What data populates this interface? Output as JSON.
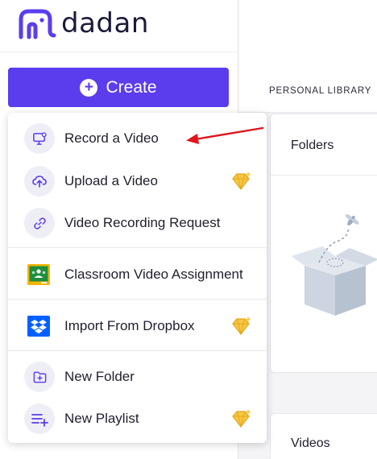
{
  "brand": {
    "name": "dadan",
    "color": "#5b3ded"
  },
  "sidebar": {
    "create_label": "Create"
  },
  "menu": {
    "items": [
      {
        "label": "Record a Video",
        "icon": "monitor-record-icon",
        "premium": false
      },
      {
        "label": "Upload a Video",
        "icon": "cloud-upload-icon",
        "premium": true
      },
      {
        "label": "Video Recording Request",
        "icon": "link-icon",
        "premium": false
      },
      {
        "label": "Classroom Video Assignment",
        "icon": "google-classroom-icon",
        "premium": false
      },
      {
        "label": "Import From Dropbox",
        "icon": "dropbox-icon",
        "premium": true
      },
      {
        "label": "New Folder",
        "icon": "folder-plus-icon",
        "premium": false
      },
      {
        "label": "New Playlist",
        "icon": "playlist-add-icon",
        "premium": true
      }
    ]
  },
  "main": {
    "tab_label": "PERSONAL LIBRARY",
    "folders_title": "Folders",
    "videos_title": "Videos"
  },
  "annotation": {
    "arrow_color": "#e0161d"
  }
}
